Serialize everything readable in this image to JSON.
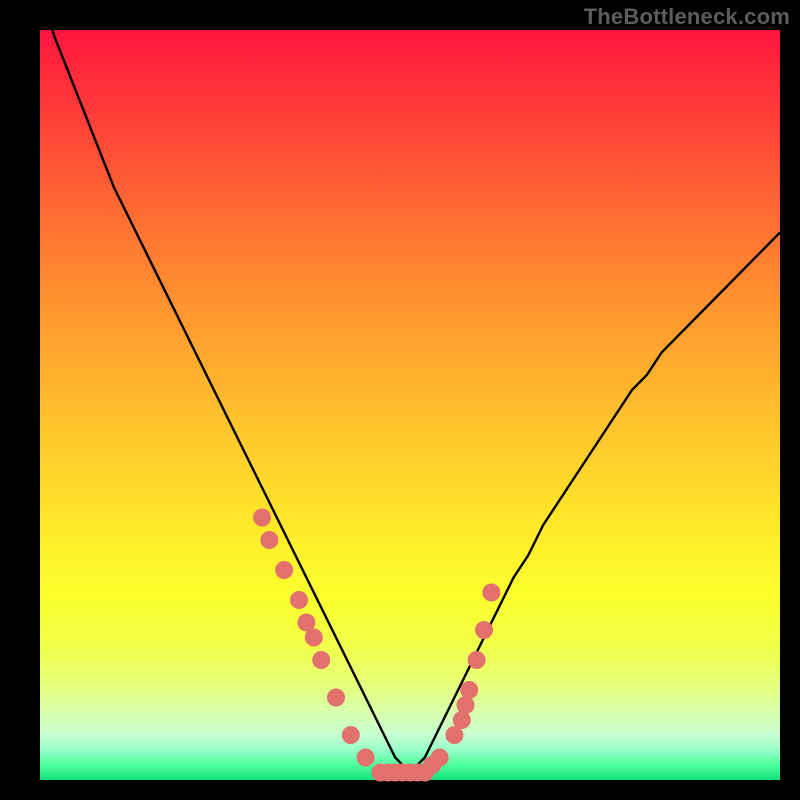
{
  "watermark": "TheBottleneck.com",
  "colors": {
    "marker": "#e2706d",
    "curve": "#000000",
    "frame_bg": "#000000"
  },
  "chart_data": {
    "type": "line",
    "title": "",
    "xlabel": "",
    "ylabel": "",
    "xlim": [
      0,
      100
    ],
    "ylim": [
      0,
      100
    ],
    "note": "Axes are unlabelled in source; x/y are percentage positions within the plot area. y values estimated from pixel positions.",
    "series": [
      {
        "name": "bottleneck-curve",
        "x": [
          0,
          2,
          4,
          6,
          8,
          10,
          12,
          14,
          16,
          18,
          20,
          22,
          24,
          26,
          28,
          30,
          32,
          34,
          36,
          38,
          40,
          42,
          44,
          46,
          48,
          50,
          52,
          54,
          56,
          58,
          60,
          62,
          64,
          66,
          68,
          70,
          72,
          74,
          76,
          78,
          80,
          82,
          84,
          86,
          88,
          90,
          92,
          94,
          96,
          98,
          100
        ],
        "y": [
          105,
          99,
          94,
          89,
          84,
          79,
          75,
          71,
          67,
          63,
          59,
          55,
          51,
          47,
          43,
          39,
          35,
          31,
          27,
          23,
          19,
          15,
          11,
          7,
          3,
          1,
          3,
          7,
          11,
          15,
          19,
          23,
          27,
          30,
          34,
          37,
          40,
          43,
          46,
          49,
          52,
          54,
          57,
          59,
          61,
          63,
          65,
          67,
          69,
          71,
          73
        ]
      }
    ],
    "markers": {
      "name": "scatter-points",
      "x": [
        30,
        31,
        33,
        35,
        36,
        37,
        38,
        40,
        42,
        44,
        46,
        47,
        48,
        49,
        50,
        51,
        52,
        53,
        54,
        56,
        57,
        57.5,
        58,
        59,
        60,
        61
      ],
      "y": [
        35,
        32,
        28,
        24,
        21,
        19,
        16,
        11,
        6,
        3,
        1,
        1,
        1,
        1,
        1,
        1,
        1,
        2,
        3,
        6,
        8,
        10,
        12,
        16,
        20,
        25
      ],
      "r": 9
    }
  }
}
